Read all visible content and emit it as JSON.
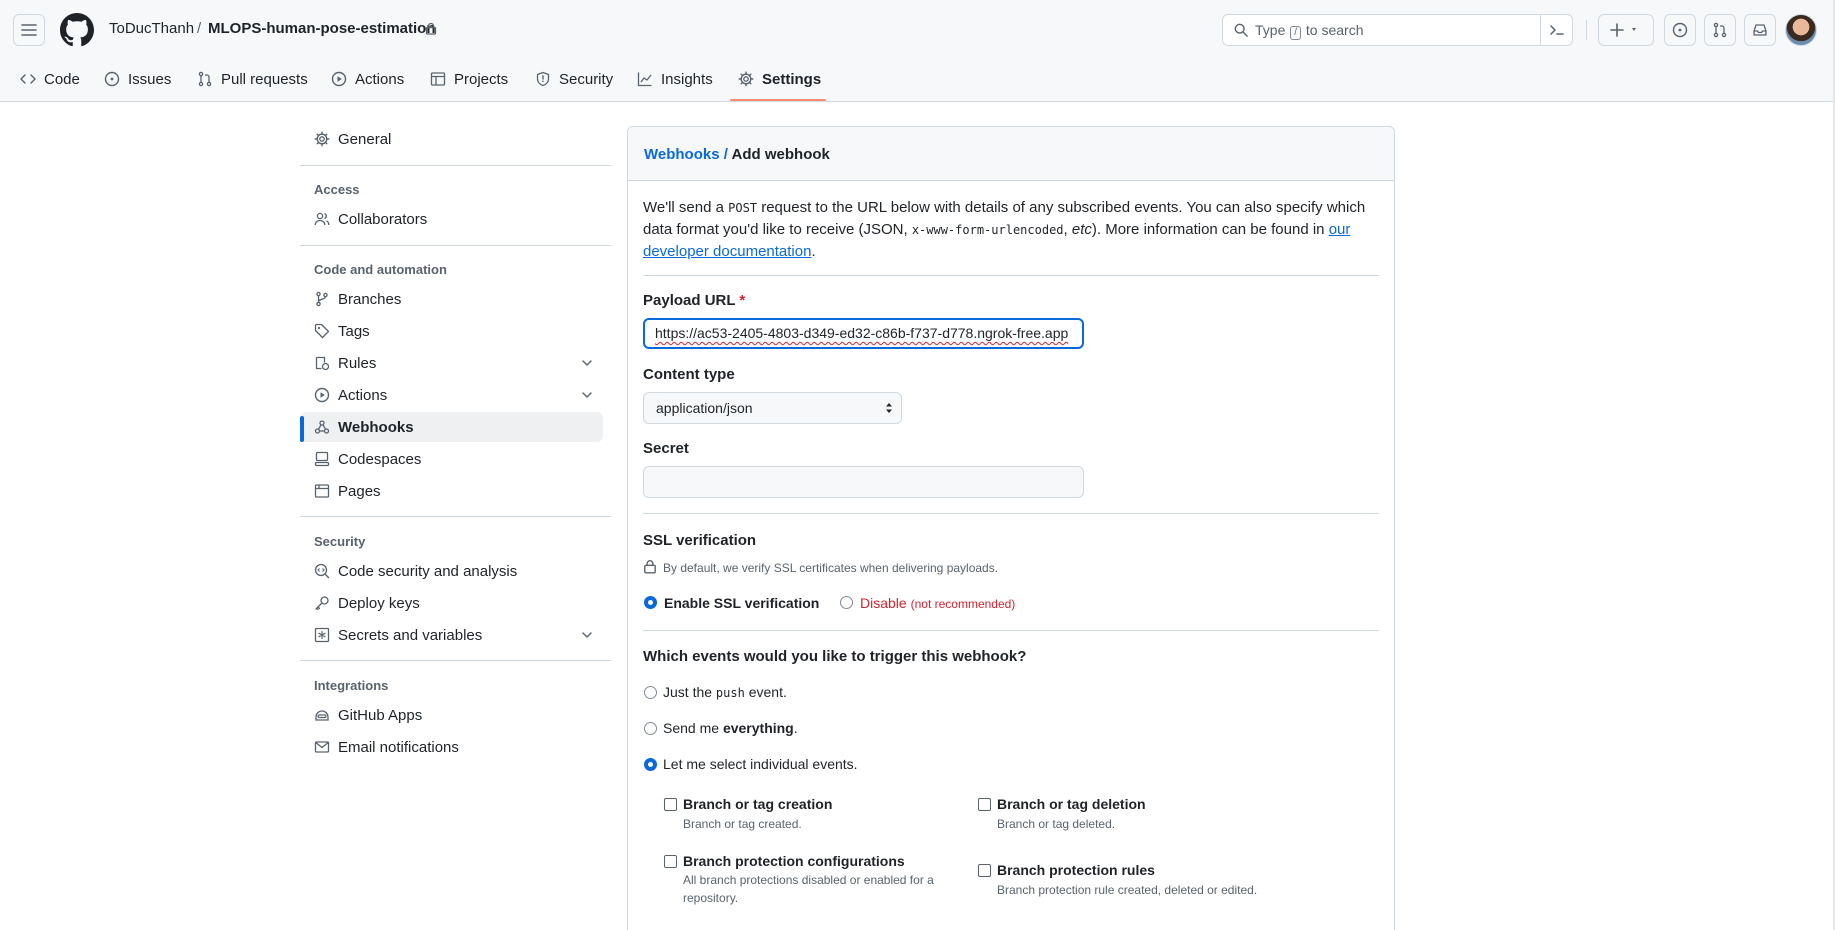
{
  "header": {
    "owner": "ToDucThanh",
    "separator": "/",
    "repo": "MLOPS-human-pose-estimation",
    "search_prefix": "Type",
    "search_key": "/",
    "search_suffix": "to search"
  },
  "tabs": [
    {
      "label": "Code",
      "icon": "code-icon"
    },
    {
      "label": "Issues",
      "icon": "issue-icon"
    },
    {
      "label": "Pull requests",
      "icon": "pull-request-icon"
    },
    {
      "label": "Actions",
      "icon": "play-icon"
    },
    {
      "label": "Projects",
      "icon": "table-icon"
    },
    {
      "label": "Security",
      "icon": "shield-icon"
    },
    {
      "label": "Insights",
      "icon": "graph-icon"
    },
    {
      "label": "Settings",
      "icon": "gear-icon",
      "active": true
    }
  ],
  "sidebar": {
    "general": "General",
    "access_heading": "Access",
    "collaborators": "Collaborators",
    "code_heading": "Code and automation",
    "branches": "Branches",
    "tags": "Tags",
    "rules": "Rules",
    "actions": "Actions",
    "webhooks": "Webhooks",
    "codespaces": "Codespaces",
    "pages": "Pages",
    "security_heading": "Security",
    "code_security": "Code security and analysis",
    "deploy_keys": "Deploy keys",
    "secrets": "Secrets and variables",
    "integrations_heading": "Integrations",
    "github_apps": "GitHub Apps",
    "email_notifications": "Email notifications"
  },
  "main": {
    "breadcrumb_link": "Webhooks",
    "breadcrumb_sep": "/",
    "breadcrumb_current": "Add webhook",
    "intro_1": "We'll send a",
    "intro_post": "POST",
    "intro_2": "request to the URL below with details of any subscribed events. You can also specify which data format you'd like to receive (JSON,",
    "intro_form": "x-www-form-urlencoded",
    "intro_3": ",",
    "intro_etc": "etc",
    "intro_4": "). More information can be found in",
    "intro_link": "our developer documentation",
    "intro_5": ".",
    "payload_label": "Payload URL",
    "payload_required": "*",
    "payload_value": "https://ac53-2405-4803-d349-ed32-c86b-f737-d778.ngrok-free.app",
    "content_type_label": "Content type",
    "content_type_value": "application/json",
    "secret_label": "Secret",
    "ssl_label": "SSL verification",
    "ssl_note": "By default, we verify SSL certificates when delivering payloads.",
    "ssl_enable": "Enable SSL verification",
    "ssl_disable": "Disable",
    "ssl_not_recommended": "(not recommended)",
    "events_label": "Which events would you like to trigger this webhook?",
    "ev_push_1": "Just the",
    "ev_push_code": "push",
    "ev_push_2": "event.",
    "ev_all_1": "Send me",
    "ev_all_bold": "everything",
    "ev_all_2": ".",
    "ev_select": "Let me select individual events.",
    "events": [
      {
        "title": "Branch or tag creation",
        "desc": "Branch or tag created."
      },
      {
        "title": "Branch or tag deletion",
        "desc": "Branch or tag deleted."
      },
      {
        "title": "Branch protection configurations",
        "desc": "All branch protections disabled or enabled for a repository."
      },
      {
        "title": "Branch protection rules",
        "desc": "Branch protection rule created, deleted or edited."
      }
    ]
  }
}
